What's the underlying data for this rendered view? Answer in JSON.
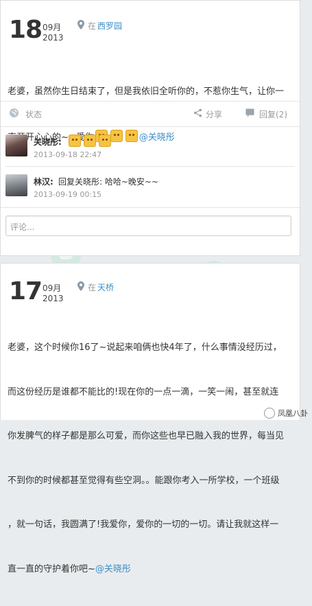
{
  "post1": {
    "day": "18",
    "month": "09月",
    "year": "2013",
    "location_prefix": "在",
    "location": "西罗园",
    "text_line1": "老婆，虽然你生日结束了，但是我依旧全听你的，不惹你生气，让你一",
    "text_line2_start": "直开开心心的~~爱你",
    "mention": "@关晓彤",
    "status": "状态",
    "share": "分享",
    "reply": "回复(2)",
    "comments": [
      {
        "author": "关晓彤:",
        "text": "",
        "time": "2013-09-18 22:47"
      },
      {
        "author": "林汉:",
        "text": "回复关晓彤: 哈哈~晚安~~",
        "time": "2013-09-19 00:15"
      }
    ],
    "comment_placeholder": "评论..."
  },
  "post2": {
    "day": "17",
    "month": "09月",
    "year": "2013",
    "location_prefix": "在",
    "location": "天桥",
    "lines": [
      "老婆，这个时候你16了~说起来咱俩也快4年了，什么事情没经历过，",
      "而这份经历是谁都不能比的!现在你的一点一滴，一笑一闹，甚至就连",
      "你发脾气的样子都是那么可爱，而你这些也早已融入我的世界，每当见",
      "不到你的时候都甚至觉得有些空洞。。能跟你考入一所学校，一个班级",
      "，就一句话，我圆满了!我爱你，爱你的一切的一切。请让我就这样一",
      "直一直的守护着你吧~"
    ],
    "mention": "@关晓彤"
  },
  "watermark": "凤凰八卦"
}
